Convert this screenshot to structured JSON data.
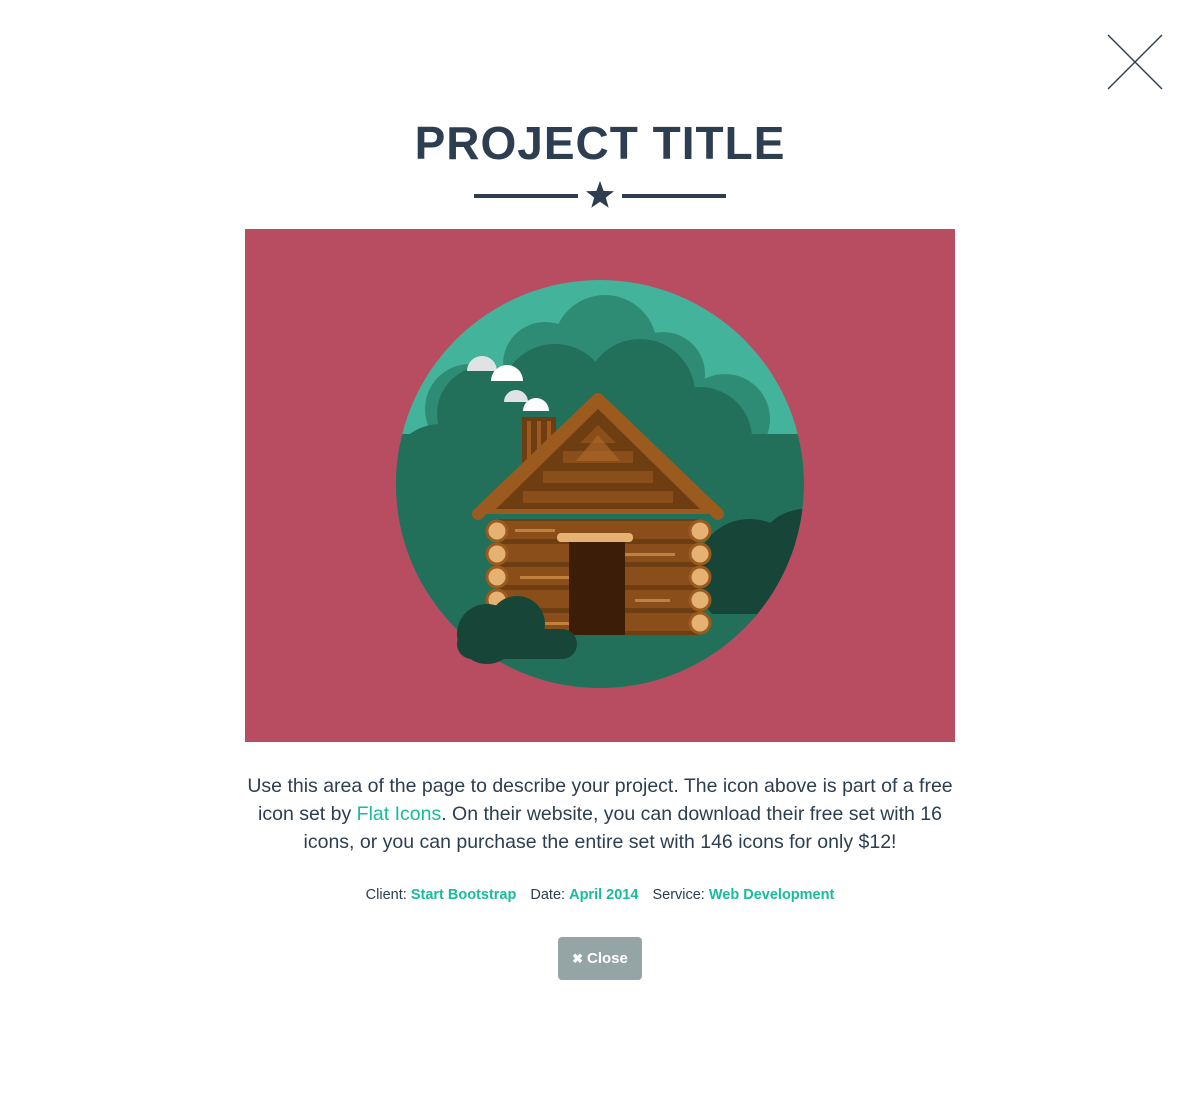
{
  "modal": {
    "title": "PROJECT TITLE",
    "description": {
      "before_link": "Use this area of the page to describe your project. The icon above is part of a free icon set by ",
      "link_text": "Flat Icons",
      "after_link": ". On their website, you can download their free set with 16 icons, or you can purchase the entire set with 146 icons for only $12!"
    },
    "details": {
      "client_label": "Client:",
      "client_value": "Start Bootstrap",
      "date_label": "Date:",
      "date_value": "April 2014",
      "service_label": "Service:",
      "service_value": "Web Development"
    },
    "close_button": {
      "icon": "✖",
      "label": "Close"
    },
    "icons": {
      "dismiss": "close-x-icon",
      "divider": "star-icon",
      "illustration": "log-cabin-illustration"
    }
  },
  "colors": {
    "heading": "#2c3e50",
    "link": "#18bc9c",
    "hero_background": "#b84d61",
    "button_background": "#95a5a6"
  }
}
